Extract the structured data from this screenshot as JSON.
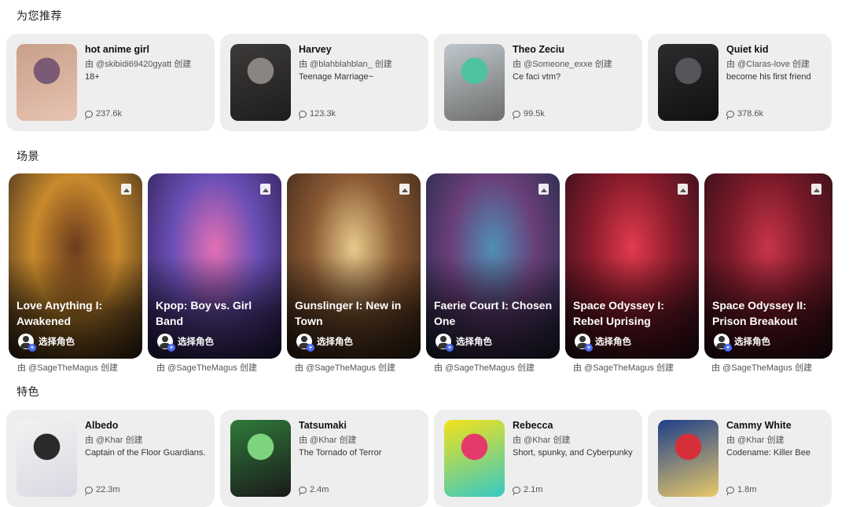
{
  "sections": {
    "recommended": "为您推荐",
    "scenes": "场景",
    "featured": "特色"
  },
  "recommended": [
    {
      "name": "hot anime girl",
      "creator": "由 @skibidi69420gyatt 创建",
      "desc": "18+",
      "count": "237.6k",
      "thumb": [
        "#c9a089",
        "#7a5a74",
        "#e7c3b2"
      ]
    },
    {
      "name": "Harvey",
      "creator": "由 @blahblahblan_ 创建",
      "desc": "Teenage Marriage~",
      "count": "123.3k",
      "thumb": [
        "#3d3a3a",
        "#8a8580",
        "#1e1c1c"
      ]
    },
    {
      "name": "Theo Zeciu",
      "creator": "由 @Someone_exxe 创建",
      "desc": "Ce faci vtm?",
      "count": "99.5k",
      "thumb": [
        "#bfc6cc",
        "#4fc3a1",
        "#6e6f6c"
      ]
    },
    {
      "name": "Quiet kid",
      "creator": "由 @Claras-love 创建",
      "desc": "become his first friend",
      "count": "378.6k",
      "thumb": [
        "#2b2b2d",
        "#55555a",
        "#111"
      ]
    }
  ],
  "scenes": [
    {
      "title": "Love Anything I: Awakened",
      "pick": "选择角色",
      "by": "由 @SageTheMagus 创建",
      "colors": [
        "#6b3a1d",
        "#c98a2c",
        "#3a2a1c"
      ]
    },
    {
      "title": "Kpop: Boy vs. Girl Band",
      "pick": "选择角色",
      "by": "由 @SageTheMagus 创建",
      "colors": [
        "#e46fb3",
        "#6a4fb5",
        "#2c1d4f"
      ]
    },
    {
      "title": "Gunslinger I: New in Town",
      "pick": "选择角色",
      "by": "由 @SageTheMagus 创建",
      "colors": [
        "#e8c98a",
        "#8a5a34",
        "#3a2416"
      ]
    },
    {
      "title": "Faerie Court I: Chosen One",
      "pick": "选择角色",
      "by": "由 @SageTheMagus 创建",
      "colors": [
        "#4f8fb4",
        "#6a3f7a",
        "#1f2a44"
      ]
    },
    {
      "title": "Space Odyssey I: Rebel Uprising",
      "pick": "选择角色",
      "by": "由 @SageTheMagus 创建",
      "colors": [
        "#e23a4d",
        "#8a1c2c",
        "#2a0f1a"
      ]
    },
    {
      "title": "Space Odyssey II: Prison Breakout",
      "pick": "选择角色",
      "by": "由 @SageTheMagus 创建",
      "colors": [
        "#c8344a",
        "#7a1a28",
        "#2b1016"
      ]
    }
  ],
  "featured": [
    {
      "name": "Albedo",
      "creator": "由 @Khar 创建",
      "desc": "Captain of the Floor Guardians.",
      "count": "22.3m",
      "thumb": [
        "#f2f2f2",
        "#2a2a2a",
        "#d9d9e3"
      ]
    },
    {
      "name": "Tatsumaki",
      "creator": "由 @Khar 创建",
      "desc": "The Tornado of Terror",
      "count": "2.4m",
      "thumb": [
        "#2f7a3a",
        "#7ed37f",
        "#1a1a1a"
      ]
    },
    {
      "name": "Rebecca",
      "creator": "由 @Khar 创建",
      "desc": "Short, spunky, and Cyberpunky",
      "count": "2.1m",
      "thumb": [
        "#f4e21a",
        "#e43a6a",
        "#36c9c4"
      ]
    },
    {
      "name": "Cammy White",
      "creator": "由 @Khar 创建",
      "desc": "Codename: Killer Bee",
      "count": "1.8m",
      "thumb": [
        "#1d3f8a",
        "#d62f3a",
        "#e8c86a"
      ]
    }
  ]
}
